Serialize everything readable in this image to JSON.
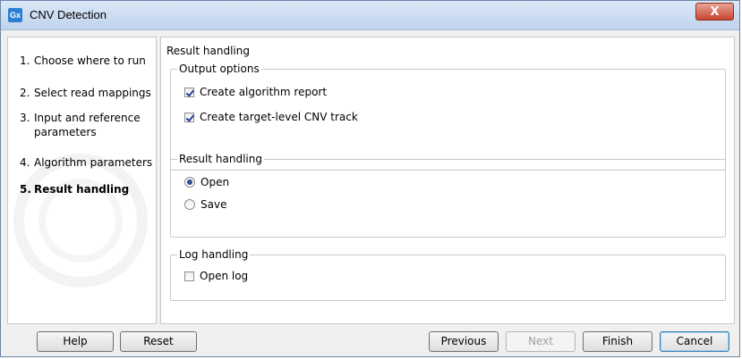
{
  "window": {
    "title": "CNV Detection",
    "app_icon_text": "Gx",
    "close_symbol": "X"
  },
  "sidebar": {
    "steps": [
      {
        "num": "1.",
        "label": "Choose where to run"
      },
      {
        "num": "2.",
        "label": "Select read mappings"
      },
      {
        "num": "3.",
        "label": "Input and reference parameters"
      },
      {
        "num": "4.",
        "label": "Algorithm parameters"
      },
      {
        "num": "5.",
        "label": "Result handling"
      }
    ]
  },
  "main": {
    "title": "Result handling",
    "output_options": {
      "legend": "Output options",
      "algorithm_report": "Create algorithm report",
      "target_track": "Create target-level CNV track"
    },
    "result_handling": {
      "legend": "Result handling",
      "open": "Open",
      "save": "Save"
    },
    "log_handling": {
      "legend": "Log handling",
      "open_log": "Open log"
    }
  },
  "buttons": {
    "help": "Help",
    "reset": "Reset",
    "previous": "Previous",
    "next": "Next",
    "finish": "Finish",
    "cancel": "Cancel"
  }
}
